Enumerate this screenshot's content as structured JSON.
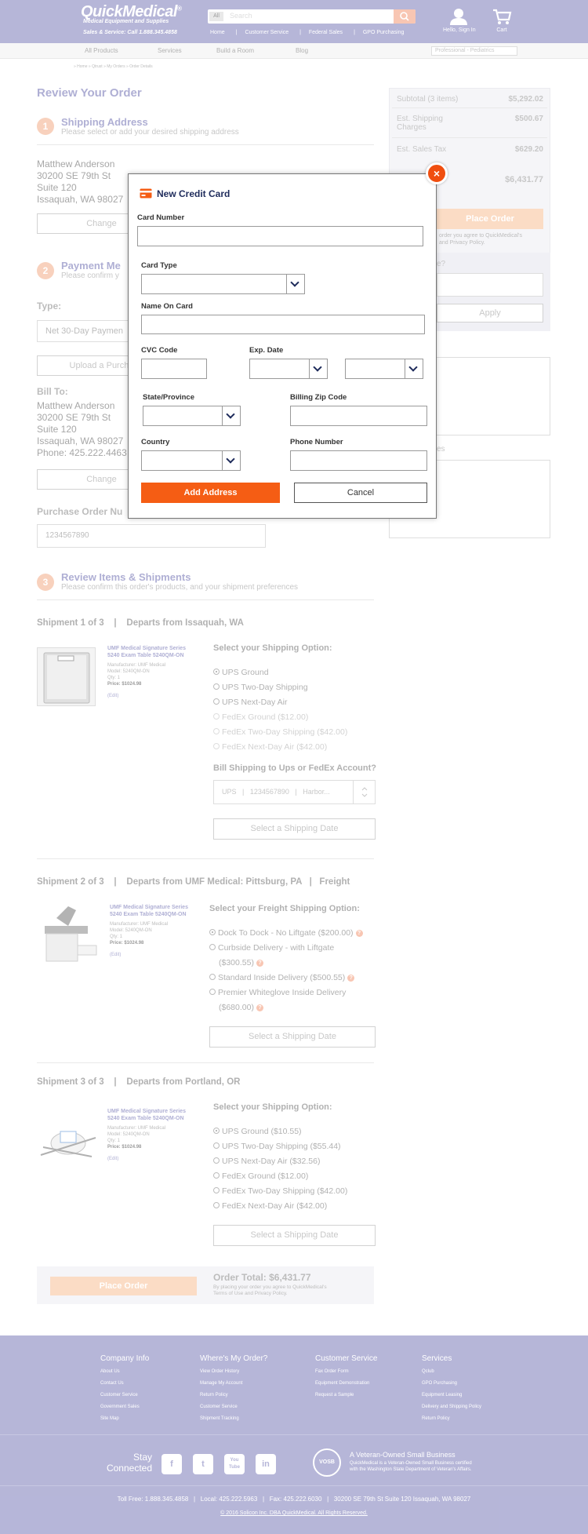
{
  "header": {
    "logo": "QuickMedical",
    "logo_reg": "®",
    "logo_sub": "Medical Equipment and Supplies",
    "tagline": "Sales & Service: Call 1.888.345.4858",
    "search_scope": "All",
    "search_placeholder": "Search",
    "links": [
      "Home",
      "Customer Service",
      "Federal Sales",
      "GPO Purchasing"
    ],
    "user_label": "Hello, Sign In",
    "cart_label": "Cart"
  },
  "nav": {
    "items": [
      "All Products",
      "Services",
      "Build a Room",
      "Blog"
    ],
    "profile_select": "Professional - Pediatrics"
  },
  "breadcrumb": "» Home » Qtrust » My Orders » Order Details",
  "page_title": "Review Your Order",
  "shipping_address": {
    "step": "1",
    "title": "Shipping Address",
    "subtitle": "Please select or add your desired shipping address",
    "lines": [
      "Matthew Anderson",
      "30200 SE 79th St",
      "Suite 120",
      "Issaquah, WA 98027"
    ],
    "change": "Change"
  },
  "payment": {
    "step": "2",
    "title": "Payment Me",
    "subtitle": "Please confirm y",
    "type_label": "Type:",
    "type_value": "Net 30-Day Paymen",
    "upload": "Upload a Purcha",
    "bill_to_label": "Bill To:",
    "bill_lines": [
      "Matthew Anderson",
      "30200 SE 79th St",
      "Suite 120",
      "Issaquah, WA 98027",
      "Phone: 425.222.4463"
    ],
    "change": "Change",
    "po_label": "Purchase Order Nu",
    "po_value": "1234567890"
  },
  "summary": {
    "rows": [
      {
        "label": "Subtotal (3 items)",
        "value": "$5,292.02"
      },
      {
        "label": "Est. Shipping Charges",
        "value": "$500.67"
      },
      {
        "label": "Est. Sales Tax",
        "value": "$629.20"
      }
    ],
    "total": "$6,431.77",
    "place_order": "Place Order",
    "agree": "order you agree to QuickMedical's",
    "agree2": "and Privacy Policy.",
    "coupon_label": "e?",
    "apply": "Apply",
    "notes_label": "es"
  },
  "review": {
    "step": "3",
    "title": "Review Items & Shipments",
    "subtitle": "Please confirm this order's products, and your shipment preferences"
  },
  "shipments": [
    {
      "header": "Shipment 1 of 3    |    Departs from Issaquah, WA",
      "product_title": "UMF Medical Signature Series 5240 Exam Table 5240QM-ON",
      "manufacturer": "Manufacturer: UMF Medical",
      "model": "Model: 5240QM-ON",
      "qty": "Qty: 1",
      "price": "Price: $1024.98",
      "edit": "(Edit)",
      "option_header": "Select your Shipping Option:",
      "options": [
        {
          "label": "UPS Ground",
          "selected": true,
          "disabled": false
        },
        {
          "label": "UPS Two-Day Shipping",
          "selected": false,
          "disabled": false
        },
        {
          "label": "UPS Next-Day Air",
          "selected": false,
          "disabled": false
        },
        {
          "label": "FedEx Ground ($12.00)",
          "selected": false,
          "disabled": true
        },
        {
          "label": "FedEx Two-Day Shipping ($42.00)",
          "selected": false,
          "disabled": true
        },
        {
          "label": "FedEx Next-Day Air ($42.00)",
          "selected": false,
          "disabled": true
        }
      ],
      "account_label": "Bill Shipping to Ups or FedEx Account?",
      "account_value": "UPS   |   1234567890   |   Harbor...",
      "date_button": "Select a Shipping Date"
    },
    {
      "header": "Shipment 2 of 3    |    Departs from UMF Medical: Pittsburg, PA   |   Freight",
      "product_title": "UMF Medical Signature Series 5240 Exam Table 5240QM-ON",
      "manufacturer": "Manufacturer: UMF Medical",
      "model": "Model: 5240QM-ON",
      "qty": "Qty: 1",
      "price": "Price: $1024.98",
      "edit": "(Edit)",
      "option_header": "Select your Freight Shipping Option:",
      "options": [
        {
          "label": "Dock To Dock - No Liftgate ($200.00)",
          "selected": true,
          "help": true
        },
        {
          "label": "Curbside Delivery - with Liftgate",
          "label2": "($300.55)",
          "selected": false,
          "help": true
        },
        {
          "label": "Standard Inside Delivery ($500.55)",
          "selected": false,
          "help": true
        },
        {
          "label": "Premier Whiteglove Inside Delivery",
          "label2": "($680.00)",
          "selected": false,
          "help": true
        }
      ],
      "date_button": "Select a Shipping Date"
    },
    {
      "header": "Shipment 3 of 3    |    Departs from Portland, OR",
      "product_title": "UMF Medical Signature Series 5240 Exam Table 5240QM-ON",
      "manufacturer": "Manufacturer: UMF Medical",
      "model": "Model: 5240QM-ON",
      "qty": "Qty: 1",
      "price": "Price: $1024.98",
      "edit": "(Edit)",
      "option_header": "Select your Shipping Option:",
      "options": [
        {
          "label": "UPS Ground ($10.55)",
          "selected": true
        },
        {
          "label": "UPS Two-Day Shipping ($55.44)",
          "selected": false
        },
        {
          "label": "UPS Next-Day Air ($32.56)",
          "selected": false
        },
        {
          "label": "FedEx Ground ($12.00)",
          "selected": false
        },
        {
          "label": "FedEx Two-Day Shipping ($42.00)",
          "selected": false
        },
        {
          "label": "FedEx Next-Day Air ($42.00)",
          "selected": false
        }
      ],
      "date_button": "Select a Shipping Date"
    }
  ],
  "bottom": {
    "place_order": "Place Order",
    "total": "Order Total: $6,431.77",
    "agree1": "By placing your order you agree to QuickMedical's",
    "agree2": "Terms of Use and Privacy Policy."
  },
  "footer": {
    "columns": [
      {
        "title": "Company Info",
        "links": [
          "About Us",
          "Contact Us",
          "Customer Service",
          "Government Sales",
          "Site Map"
        ]
      },
      {
        "title": "Where's My Order?",
        "links": [
          "View Order History",
          "Manage My Account",
          "Return Policy",
          "Customer Service",
          "Shipment Tracking"
        ]
      },
      {
        "title": "Customer Service",
        "links": [
          "Fax Order Form",
          "Equipment Demonstration",
          "Request a Sample"
        ]
      },
      {
        "title": "Services",
        "links": [
          "Qclub",
          "GPO Purchasing",
          "Equipment Leasing",
          "Delivery and Shipping Policy",
          "Return Policy"
        ]
      }
    ],
    "stay_connected": [
      "Stay",
      "Connected"
    ],
    "social": [
      "f",
      "t",
      "You Tube",
      "in"
    ],
    "badge": "VOSB",
    "veteran_title": "A Veteran-Owned Small Business",
    "veteran_desc1": "QuickMedical is a Veteran-Owned Small Business certified",
    "veteran_desc2": "with the Washington State Department of Veteran's Affairs.",
    "contact": "Toll Free: 1.888.345.4858   |   Local: 425.222.5963   |   Fax: 425.222.6030   |   30200 SE 79th St Suite 120 Issaquah, WA 98027",
    "copyright": "© 2016 Solicon Inc. DBA QuickMedical. All Rights Reserved."
  },
  "modal": {
    "title": "New Credit Card",
    "close": "×",
    "card_number_label": "Card Number",
    "card_type_label": "Card Type",
    "name_label": "Name On Card",
    "cvc_label": "CVC Code",
    "exp_label": "Exp. Date",
    "state_label": "State/Province",
    "zip_label": "Billing Zip Code",
    "country_label": "Country",
    "phone_label": "Phone Number",
    "add_button": "Add Address",
    "cancel_button": "Cancel"
  },
  "colors": {
    "brand": "#8f8fc4",
    "accent": "#f55d14",
    "modal_title": "#1e2b5b"
  }
}
